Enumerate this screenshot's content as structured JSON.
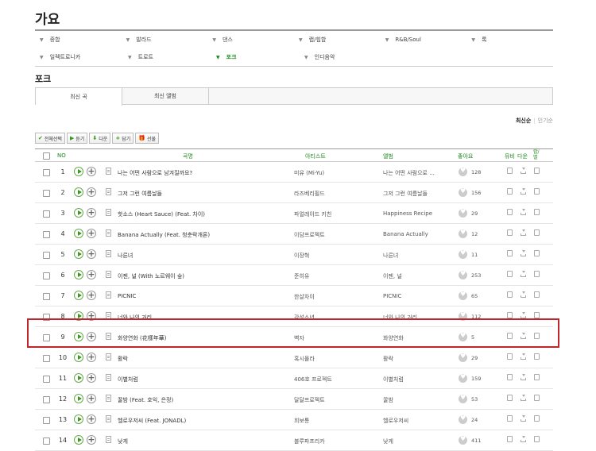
{
  "page_title": "가요",
  "genres_row1": [
    "종합",
    "발라드",
    "댄스",
    "랩/힙합",
    "R&B/Soul",
    "록"
  ],
  "genres_row2": [
    "일렉트로니카",
    "트로트",
    "포크",
    "인디음악"
  ],
  "active_genre": "포크",
  "section_title": "포크",
  "tabs": [
    "최신 곡",
    "최신 앨범"
  ],
  "sort": {
    "latest": "최신순",
    "popular": "인기순"
  },
  "toolbar": [
    {
      "icon": "check-icon",
      "glyph": "✔",
      "label": "전체선택"
    },
    {
      "icon": "play-icon",
      "glyph": "▶",
      "label": "듣기"
    },
    {
      "icon": "download-icon",
      "glyph": "⬇",
      "label": "다운"
    },
    {
      "icon": "plus-icon",
      "glyph": "+",
      "label": "담기"
    },
    {
      "icon": "gift-icon",
      "glyph": "🎁",
      "label": "선물"
    }
  ],
  "headers": {
    "no": "NO",
    "song": "곡명",
    "artist": "아티스트",
    "album": "앨범",
    "like": "좋아요",
    "mv": "뮤비",
    "down": "다운",
    "lyrics1": "랍/",
    "lyrics2": "별"
  },
  "songs": [
    {
      "no": "1",
      "title": "나는 어떤 사람으로 남겨질까요?",
      "artist": "미유 (Mi-Yu)",
      "album": "나는 어떤 사람으로 ...",
      "likes": "128"
    },
    {
      "no": "2",
      "title": "그저 그런 여름날들",
      "artist": "라즈베리필드",
      "album": "그저 그런 여름날들",
      "likes": "156"
    },
    {
      "no": "3",
      "title": "핫소스 (Heart Sauce) (Feat. 차이)",
      "artist": "파얼레이드 키친",
      "album": "Happiness Recipe",
      "likes": "29"
    },
    {
      "no": "4",
      "title": "Banana Actually (Feat. 청춘락개론)",
      "artist": "이담프로젝트",
      "album": "Banana Actually",
      "likes": "12"
    },
    {
      "no": "5",
      "title": "나른녀",
      "artist": "이장혁",
      "album": "나른녀",
      "likes": "11"
    },
    {
      "no": "6",
      "title": "이젠, 널 (With 노르웨이 숲)",
      "artist": "준히유",
      "album": "이젠, 널",
      "likes": "253"
    },
    {
      "no": "7",
      "title": "PICNIC",
      "artist": "한살차이",
      "album": "PICNIC",
      "likes": "65"
    },
    {
      "no": "8",
      "title": "너와 나의 거리",
      "artist": "감성소년",
      "album": "너와 나의 거리",
      "likes": "112"
    },
    {
      "no": "9",
      "title": "화양연화 (花樣年華)",
      "artist": "벽자",
      "album": "화양연화",
      "likes": "5"
    },
    {
      "no": "10",
      "title": "활락",
      "artist": "혹시몰라",
      "album": "활락",
      "likes": "29"
    },
    {
      "no": "11",
      "title": "이별처럼",
      "artist": "406호 프로젝트",
      "album": "이별처럼",
      "likes": "159"
    },
    {
      "no": "12",
      "title": "꿀밤 (Feat. 호익, 은정)",
      "artist": "달달프로젝트",
      "album": "꿀밤",
      "likes": "53"
    },
    {
      "no": "13",
      "title": "헬로우저씨 (Feat. JONADL)",
      "artist": "희보통",
      "album": "헬로우저씨",
      "likes": "24"
    },
    {
      "no": "14",
      "title": "낮게",
      "artist": "블루파프리카",
      "album": "낮게",
      "likes": "411"
    }
  ]
}
